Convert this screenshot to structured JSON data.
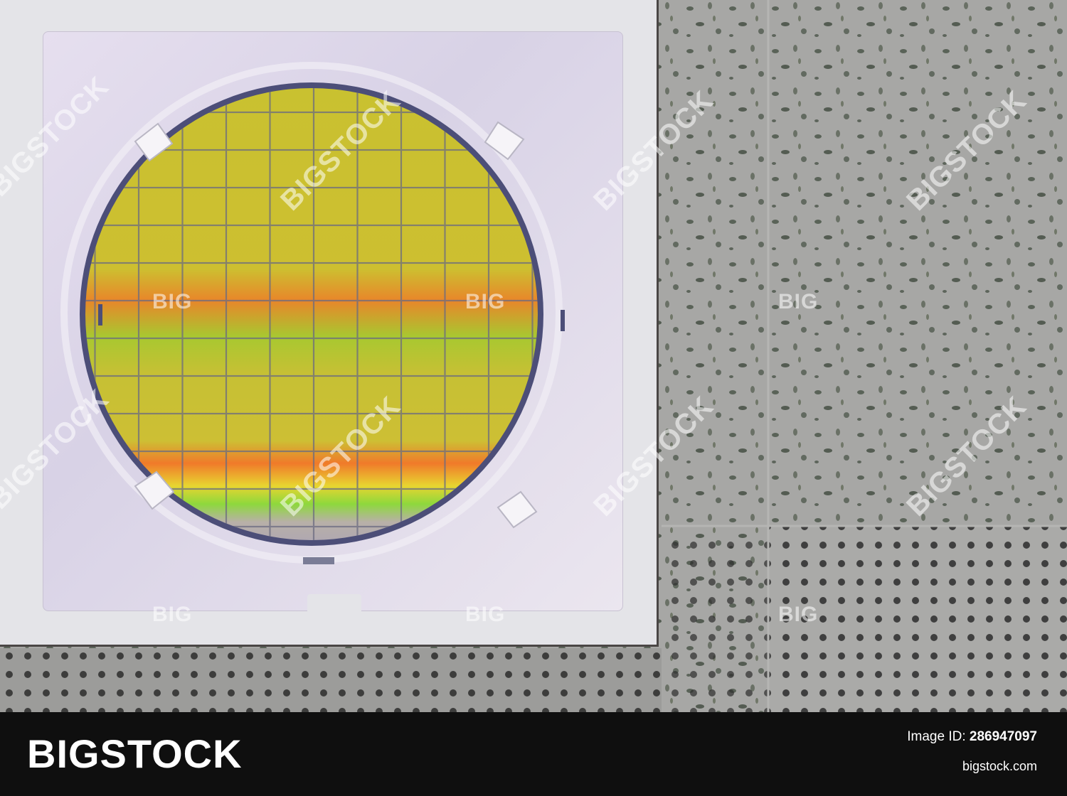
{
  "watermark": {
    "diagonal_text": "BIGSTOCK",
    "small_text": "BIG"
  },
  "footer": {
    "brand": "BIGSTOCK",
    "image_id_label": "Image ID:",
    "image_id": "286947097",
    "site": "bigstock.com"
  },
  "colors": {
    "footer_bg": "#0f0f0f",
    "wafer_yellow": "#c8c030",
    "carrier": "#e4e4e8"
  }
}
